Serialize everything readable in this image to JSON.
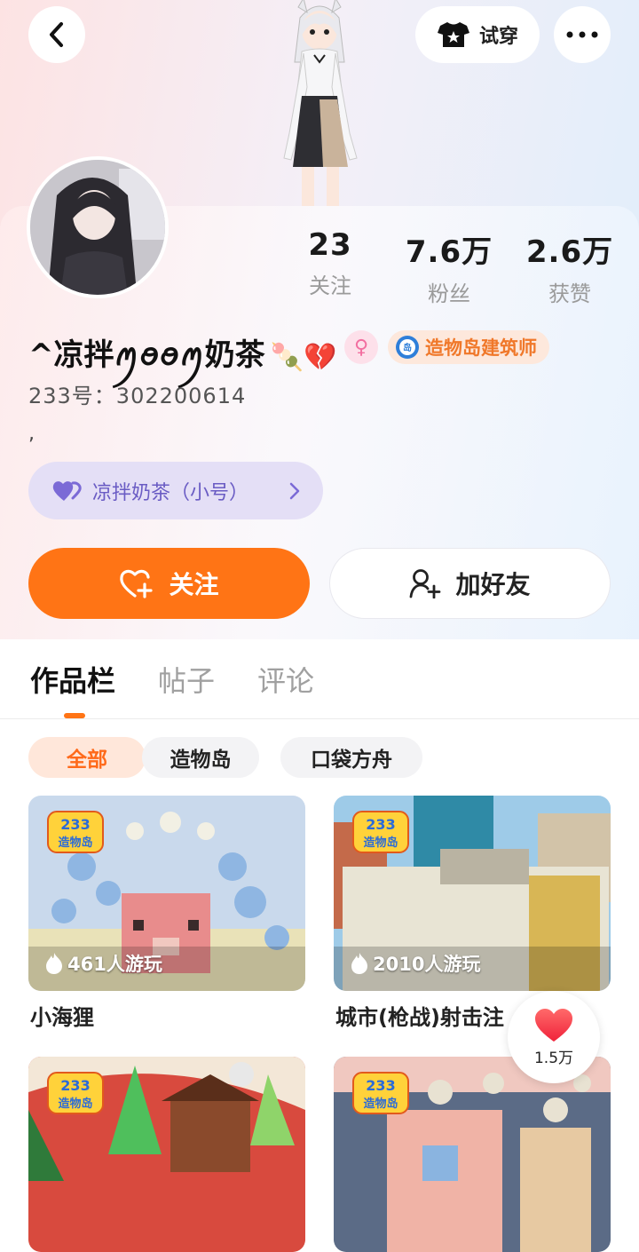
{
  "header": {
    "try_on_label": "试穿"
  },
  "stats": [
    {
      "value": "23",
      "label": "关注"
    },
    {
      "value": "7.6万",
      "label": "粉丝"
    },
    {
      "value": "2.6万",
      "label": "获赞"
    }
  ],
  "profile": {
    "username": "^凉拌ꪑꪮꪮꪑ奶茶",
    "username_emoji": "🍡💔",
    "gender_symbol": "♀",
    "badge_label": "造物岛建筑师",
    "uid": "233号：302200614",
    "bio": ",",
    "alt_account": "凉拌奶茶（小号）"
  },
  "actions": {
    "follow_label": "关注",
    "add_friend_label": "加好友"
  },
  "tabs": [
    {
      "label": "作品栏",
      "active": true
    },
    {
      "label": "帖子",
      "active": false
    },
    {
      "label": "评论",
      "active": false
    }
  ],
  "chips": [
    {
      "label": "全部",
      "active": true
    },
    {
      "label": "造物岛",
      "active": false
    },
    {
      "label": "口袋方舟",
      "active": false
    }
  ],
  "games": [
    {
      "title": "小海狸",
      "plays": "461人游玩",
      "logo": "233造物岛"
    },
    {
      "title": "城市(枪战)射击注",
      "plays": "2010人游玩",
      "logo": "233造物岛"
    },
    {
      "title": "",
      "plays": "",
      "logo": "233造物岛"
    },
    {
      "title": "",
      "plays": "",
      "logo": "233造物岛"
    }
  ],
  "like_fab": {
    "count": "1.5万"
  },
  "colors": {
    "accent": "#ff7415",
    "badge_text": "#f0782a",
    "alt_account_bg": "#e4dff6",
    "alt_account_text": "#6a5cc4"
  }
}
